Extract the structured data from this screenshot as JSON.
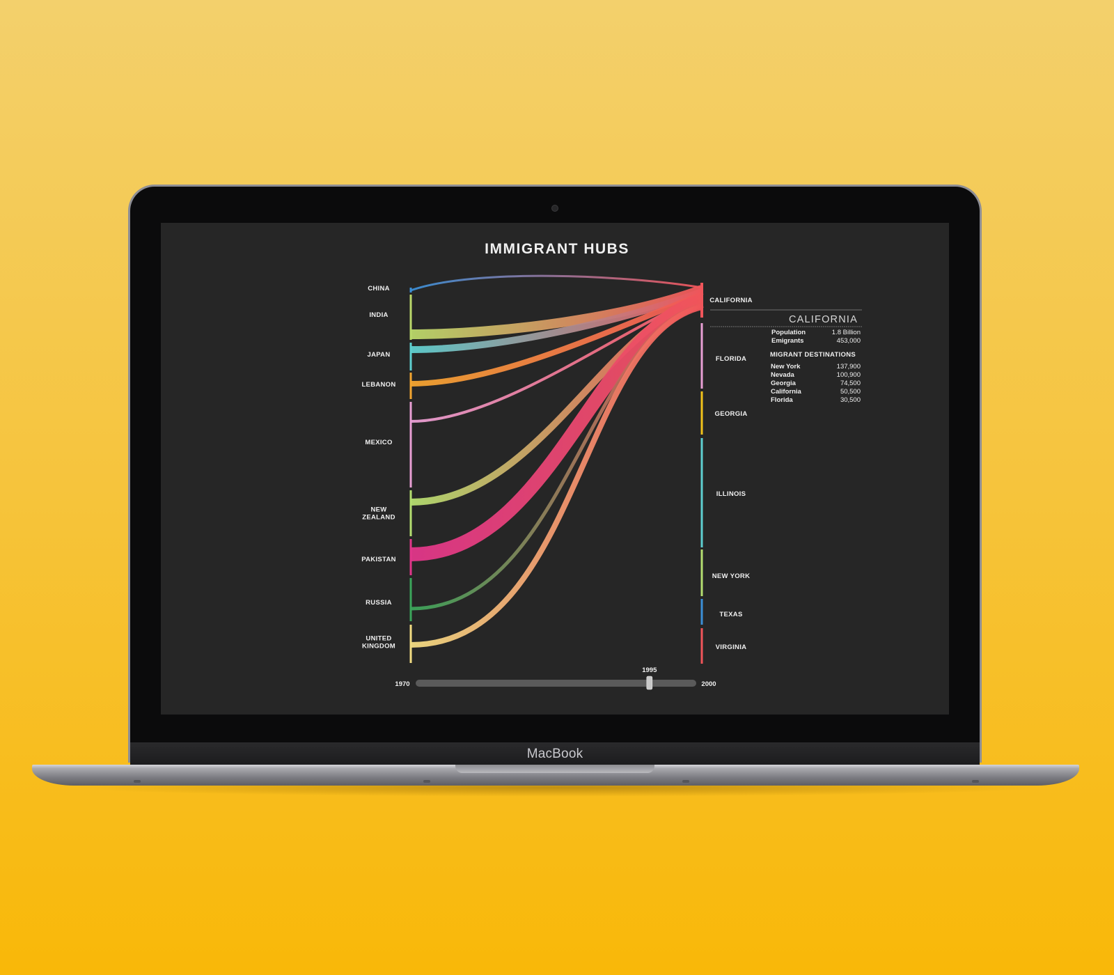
{
  "device": {
    "brand": "MacBook"
  },
  "title": "IMMIGRANT HUBS",
  "colors": {
    "background": "#262626",
    "text": "#f0f0f0",
    "destination_flow": "#f0555a"
  },
  "sources": [
    {
      "name": "CHINA",
      "color": "#3b8fd6"
    },
    {
      "name": "INDIA",
      "color": "#b9d86a"
    },
    {
      "name": "JAPAN",
      "color": "#5ecfd0"
    },
    {
      "name": "LEBANON",
      "color": "#f3a530"
    },
    {
      "name": "MEXICO",
      "color": "#e89fd4"
    },
    {
      "name": "NEW ZEALAND",
      "lines": [
        "NEW",
        "ZEALAND"
      ],
      "color": "#b4de70"
    },
    {
      "name": "PAKISTAN",
      "color": "#e0368a"
    },
    {
      "name": "RUSSIA",
      "color": "#3ba55a"
    },
    {
      "name": "UNITED KINGDOM",
      "lines": [
        "UNITED",
        "KINGDOM"
      ],
      "color": "#f2dc82"
    }
  ],
  "destinations": [
    {
      "name": "CALIFORNIA",
      "color": "#f0555a"
    },
    {
      "name": "FLORIDA",
      "color": "#e89fd4"
    },
    {
      "name": "GEORGIA",
      "color": "#f1c21b"
    },
    {
      "name": "ILLINOIS",
      "color": "#5ecfd0"
    },
    {
      "name": "NEW YORK",
      "color": "#b4de70"
    },
    {
      "name": "TEXAS",
      "color": "#3b8fd6"
    },
    {
      "name": "VIRGINIA",
      "color": "#f0555a"
    }
  ],
  "info_panel": {
    "heading": "CALIFORNIA",
    "stats": [
      {
        "label": "Population",
        "value": "1.8 Billion"
      },
      {
        "label": "Emigrants",
        "value": "453,000"
      }
    ],
    "destinations_heading": "MIGRANT DESTINATIONS",
    "destinations": [
      {
        "label": "New York",
        "value": "137,900"
      },
      {
        "label": "Nevada",
        "value": "100,900"
      },
      {
        "label": "Georgia",
        "value": "74,500"
      },
      {
        "label": "California",
        "value": "50,500"
      },
      {
        "label": "Florida",
        "value": "30,500"
      }
    ]
  },
  "timeline": {
    "start": "1970",
    "end": "2000",
    "start_year": 1970,
    "end_year": 2000,
    "current": "1995",
    "current_year": 1995
  }
}
